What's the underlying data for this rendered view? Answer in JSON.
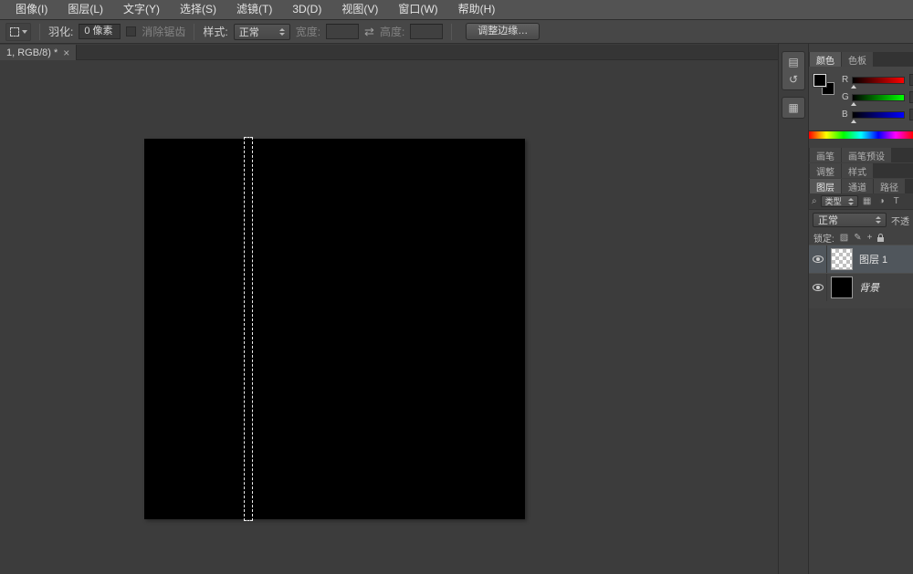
{
  "colors": {
    "menubar_bg": "#535353",
    "optionsbar_bg": "#474747",
    "canvas_area_bg": "#3c3c3c",
    "canvas_bg": "#000000",
    "panel_bg": "#424242",
    "selected_layer_bg": "#50565c",
    "channel_r": "#ff0000",
    "channel_g": "#00ff00",
    "channel_b": "#0000ff"
  },
  "menubar": {
    "items": [
      {
        "label": "图像(I)"
      },
      {
        "label": "图层(L)"
      },
      {
        "label": "文字(Y)"
      },
      {
        "label": "选择(S)"
      },
      {
        "label": "滤镜(T)"
      },
      {
        "label": "3D(D)"
      },
      {
        "label": "视图(V)"
      },
      {
        "label": "窗口(W)"
      },
      {
        "label": "帮助(H)"
      }
    ]
  },
  "options": {
    "feather_label": "羽化:",
    "feather_value": "0 像素",
    "antialias_label": "消除锯齿",
    "style_label": "样式:",
    "style_value": "正常",
    "width_label": "宽度:",
    "width_value": "",
    "swap_icon": "⇄",
    "height_label": "高度:",
    "height_value": "",
    "refine_edge_label": "调整边缘…"
  },
  "document_tab": {
    "title": "1, RGB/8) *",
    "close_icon": "×"
  },
  "collapsed_dock": {
    "icons": [
      {
        "glyph": "▤"
      },
      {
        "glyph": "↺"
      },
      {
        "glyph": "▦"
      }
    ]
  },
  "panels": {
    "color": {
      "tabs": [
        {
          "label": "颜色"
        },
        {
          "label": "色板"
        }
      ],
      "channels": [
        {
          "label": "R"
        },
        {
          "label": "G"
        },
        {
          "label": "B"
        }
      ]
    },
    "brush_row": {
      "tabs": [
        {
          "label": "画笔"
        },
        {
          "label": "画笔预设"
        }
      ]
    },
    "adjust_row": {
      "tabs": [
        {
          "label": "调整"
        },
        {
          "label": "样式"
        }
      ]
    },
    "layers": {
      "tabs": [
        {
          "label": "图层"
        },
        {
          "label": "通道"
        },
        {
          "label": "路径"
        }
      ],
      "filter": {
        "search_icon": "⌕",
        "type_label": "类型"
      },
      "filter_icons": [
        {
          "glyph": "▦"
        },
        {
          "glyph": "◑"
        },
        {
          "glyph": "T"
        }
      ],
      "blend_mode": "正常",
      "opacity_label": "不透",
      "lock_label": "锁定:",
      "lock_icons": [
        {
          "glyph": "▨"
        },
        {
          "glyph": "✎"
        },
        {
          "glyph": "+"
        }
      ],
      "rows": [
        {
          "name": "图层 1"
        },
        {
          "name": "背景"
        }
      ]
    }
  }
}
